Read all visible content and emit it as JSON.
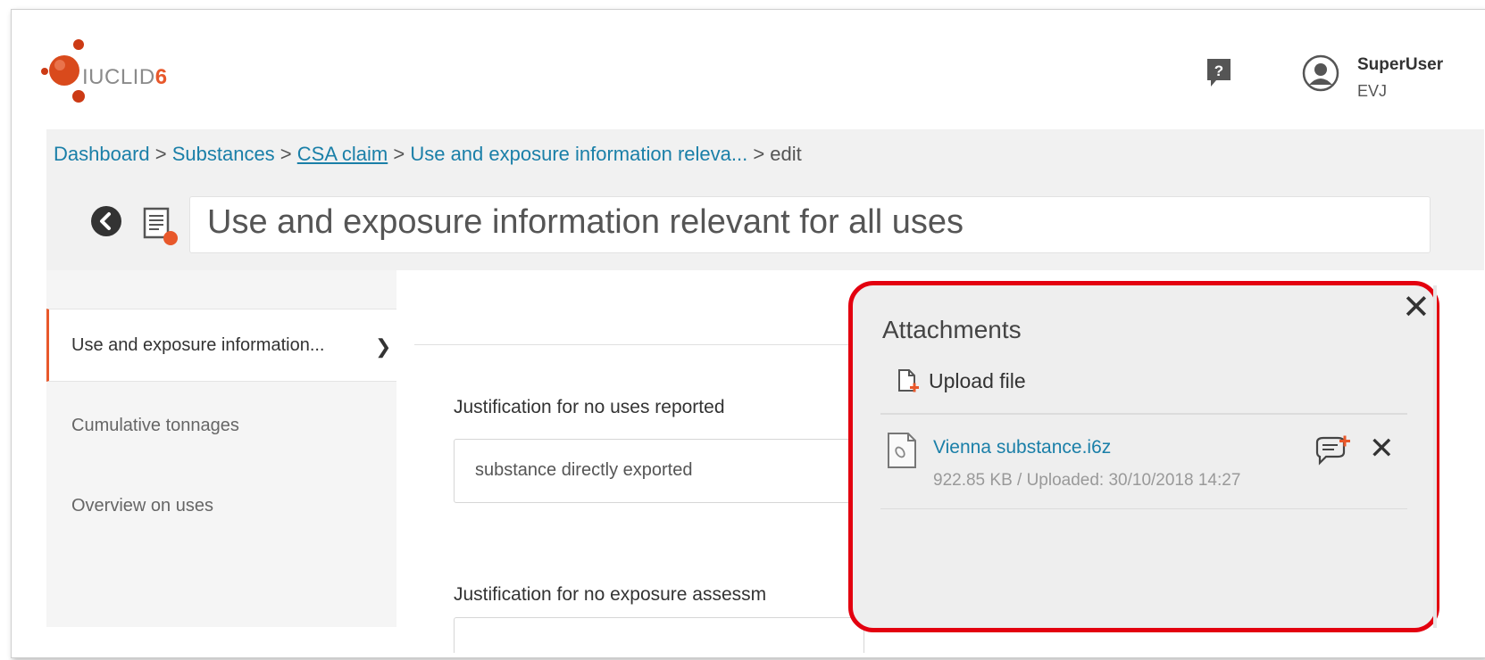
{
  "header": {
    "logo_text": "IUCLID",
    "logo_version": "6",
    "user_name": "SuperUser",
    "user_org": "EVJ"
  },
  "breadcrumb": {
    "dashboard": "Dashboard",
    "sep1": " > ",
    "substances": "Substances",
    "sep2": " > ",
    "csa_claim": "CSA claim",
    "sep3": " > ",
    "section": "Use and exposure information releva...",
    "sep4": " > ",
    "current": "edit"
  },
  "document": {
    "title": "Use and exposure information relevant for all uses"
  },
  "left_nav": {
    "active": "Use and exposure information...",
    "items": [
      "Cumulative tonnages",
      "Overview on uses"
    ]
  },
  "form": {
    "field1_label": "Justification for no uses reported",
    "field1_value": "substance directly exported",
    "field2_label": "Justification for no exposure assessm"
  },
  "attachments": {
    "title": "Attachments",
    "upload_label": "Upload file",
    "files": [
      {
        "name": "Vienna substance.i6z",
        "meta": "922.85 KB / Uploaded: 30/10/2018 14:27"
      }
    ]
  },
  "colors": {
    "accent": "#e8582b",
    "link": "#1a7fa8",
    "highlight": "#e3000f"
  }
}
